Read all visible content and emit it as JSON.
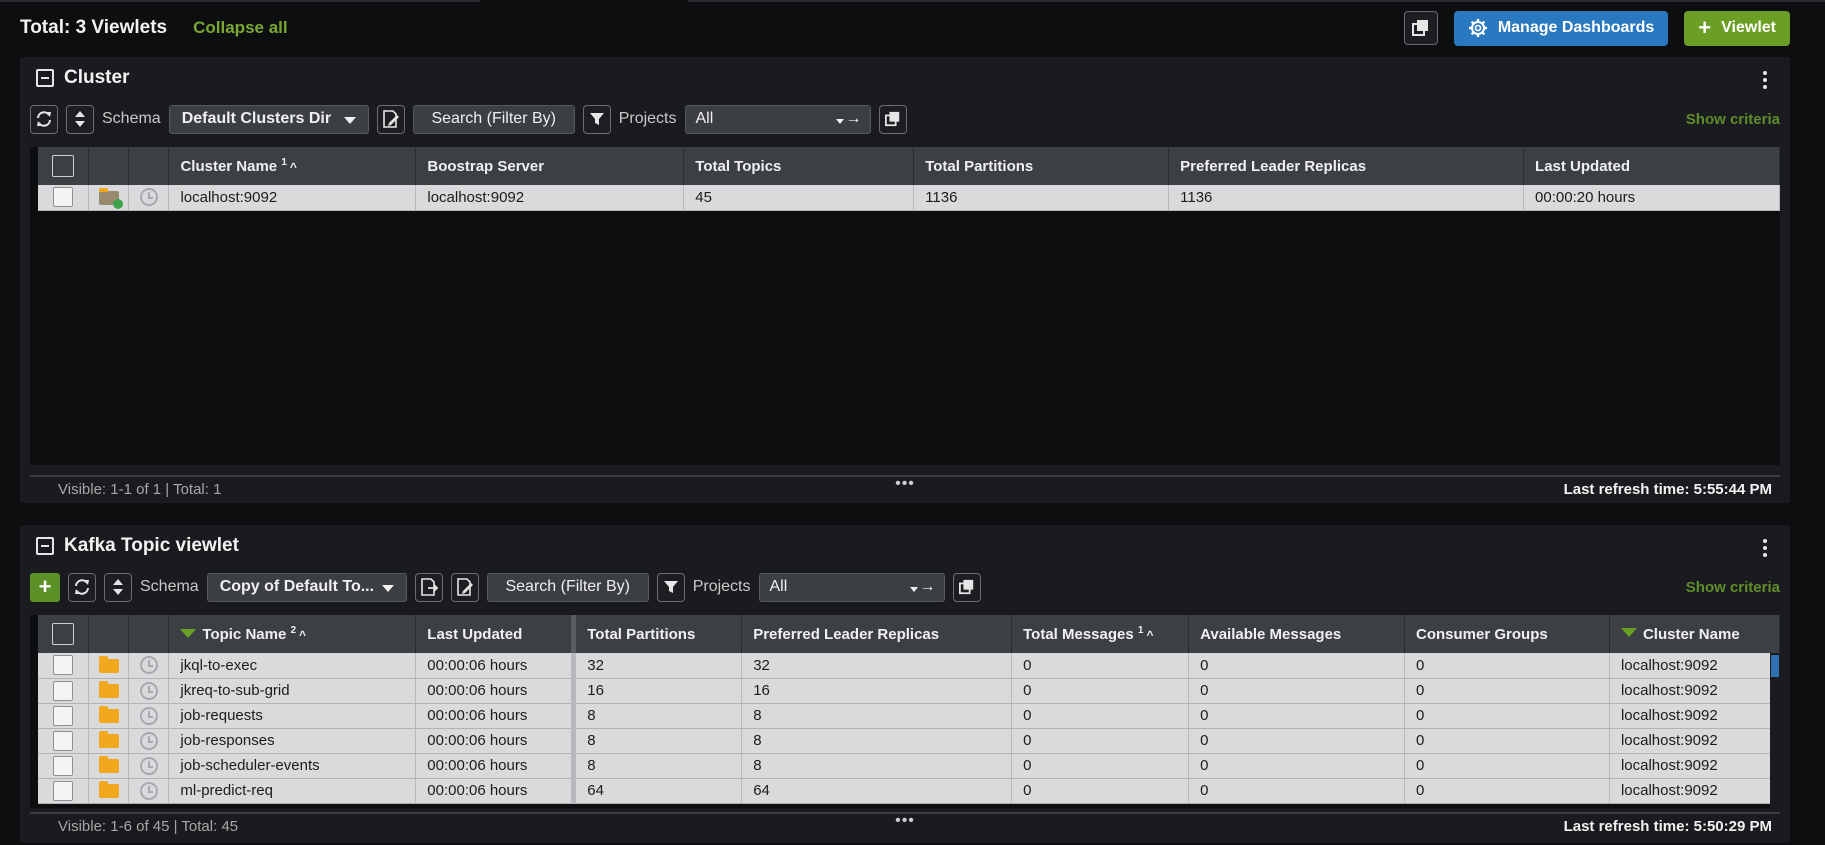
{
  "header": {
    "total_label": "Total: 3 Viewlets",
    "collapse_all": "Collapse all",
    "manage_dashboards": "Manage Dashboards",
    "add_viewlet": "Viewlet"
  },
  "cluster_panel": {
    "title": "Cluster",
    "schema_label": "Schema",
    "schema_value": "Default Clusters Dir",
    "search_placeholder": "Search (Filter By)",
    "projects_label": "Projects",
    "projects_value": "All",
    "show_criteria": "Show criteria",
    "columns": [
      "Cluster Name",
      "Boostrap Server",
      "Total Topics",
      "Total Partitions",
      "Preferred Leader Replicas",
      "Last Updated"
    ],
    "sort_index": "1",
    "rows": [
      [
        "localhost:9092",
        "localhost:9092",
        "45",
        "1136",
        "1136",
        "00:00:20 hours"
      ]
    ],
    "visible_text": "Visible: 1-1 of 1 | Total: 1",
    "more": "•••",
    "refresh_text": "Last refresh time: 5:55:44 PM"
  },
  "topic_panel": {
    "title": "Kafka Topic viewlet",
    "schema_label": "Schema",
    "schema_value": "Copy of Default To...",
    "search_placeholder": "Search (Filter By)",
    "projects_label": "Projects",
    "projects_value": "All",
    "show_criteria": "Show criteria",
    "columns": [
      "Topic Name",
      "Last Updated",
      "Total Partitions",
      "Preferred Leader Replicas",
      "Total Messages",
      "Available Messages",
      "Consumer Groups",
      "Cluster Name"
    ],
    "topic_sort_index": "2",
    "messages_sort_index": "1",
    "rows": [
      [
        "jkql-to-exec",
        "00:00:06 hours",
        "32",
        "32",
        "0",
        "0",
        "0",
        "localhost:9092"
      ],
      [
        "jkreq-to-sub-grid",
        "00:00:06 hours",
        "16",
        "16",
        "0",
        "0",
        "0",
        "localhost:9092"
      ],
      [
        "job-requests",
        "00:00:06 hours",
        "8",
        "8",
        "0",
        "0",
        "0",
        "localhost:9092"
      ],
      [
        "job-responses",
        "00:00:06 hours",
        "8",
        "8",
        "0",
        "0",
        "0",
        "localhost:9092"
      ],
      [
        "job-scheduler-events",
        "00:00:06 hours",
        "8",
        "8",
        "0",
        "0",
        "0",
        "localhost:9092"
      ],
      [
        "ml-predict-req",
        "00:00:06 hours",
        "64",
        "64",
        "0",
        "0",
        "0",
        "localhost:9092"
      ]
    ],
    "visible_text": "Visible: 1-6 of 45 | Total: 45",
    "more": "•••",
    "refresh_text": "Last refresh time: 5:50:29 PM"
  },
  "colors": {
    "accent_green": "#6a9e24",
    "accent_blue": "#2a78c0",
    "link_green": "#78a832"
  }
}
